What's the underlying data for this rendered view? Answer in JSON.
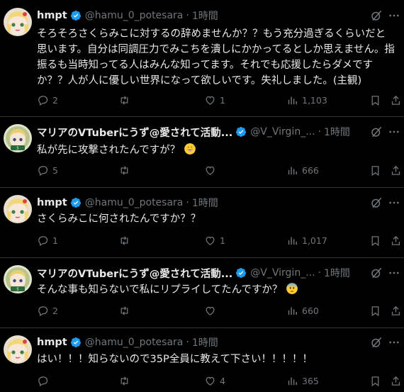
{
  "posts": [
    {
      "name": "hmpt",
      "handle": "@hamu_0_potesara",
      "dot": "·",
      "time": "1時間",
      "text": "そろそろさくらみこに対するの辞めませんか？？もう充分過ぎるくらいだと思います。自分は同調圧力でみこちを潰しにかかってるとしか思えません。指振るも当時知ってる人はみんな知ってます。それでも応援したらダメですか？？人が人に優しい世界になって欲しいです。失礼しました。(主観)",
      "emoji": "",
      "replies": "2",
      "retweets": "",
      "likes": "1",
      "views": "1,103",
      "avatar": "hmpt"
    },
    {
      "name": "マリアのVTuberにうず@愛されて活動...",
      "handle": "@V_Virgin_...",
      "dot": "·",
      "time": "1時間",
      "text": "私が先に攻撃されたんですが？",
      "emoji": "grin-sweat",
      "replies": "5",
      "retweets": "",
      "likes": "",
      "views": "666",
      "avatar": "maria"
    },
    {
      "name": "hmpt",
      "handle": "@hamu_0_potesara",
      "dot": "·",
      "time": "1時間",
      "text": "さくらみこに何されたんですか？？",
      "emoji": "",
      "replies": "1",
      "retweets": "",
      "likes": "1",
      "views": "1,017",
      "avatar": "hmpt"
    },
    {
      "name": "マリアのVTuberにうず@愛されて活動...",
      "handle": "@V_Virgin_...",
      "dot": "·",
      "time": "1時間",
      "text": "そんな事も知らないで私にリプライしてたんですか？",
      "emoji": "anxious-sweat",
      "replies": "2",
      "retweets": "",
      "likes": "",
      "views": "660",
      "avatar": "maria"
    },
    {
      "name": "hmpt",
      "handle": "@hamu_0_potesara",
      "dot": "·",
      "time": "1時間",
      "text": "はい！！！知らないので35P全員に教えて下さい！！！！！",
      "emoji": "",
      "replies": "",
      "retweets": "",
      "likes": "4",
      "views": "365",
      "avatar": "hmpt"
    }
  ],
  "icons": {
    "verified": "verified-badge-icon",
    "grok": "grok-icon",
    "more": "more-icon",
    "reply": "reply-icon",
    "retweet": "retweet-icon",
    "like": "like-icon",
    "views": "views-icon",
    "bookmark": "bookmark-icon",
    "share": "share-icon"
  },
  "colors": {
    "background": "#000000",
    "text": "#e7e9ea",
    "muted": "#71767b",
    "verified": "#1d9bf0",
    "divider": "#2f3336"
  }
}
